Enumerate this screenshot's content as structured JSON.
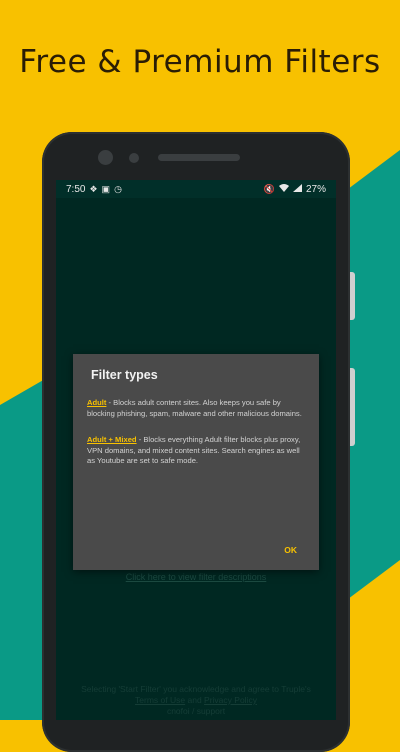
{
  "banner": {
    "headline": "Free & Premium Filters"
  },
  "colors": {
    "brand_yellow": "#F8C100",
    "brand_teal": "#0A9A86",
    "screen_bg": "#003B33"
  },
  "status_bar": {
    "time": "7:50",
    "left_icons": [
      "dropbox-icon",
      "image-icon",
      "clock-icon"
    ],
    "right_icons": [
      "mute-icon",
      "wifi-icon",
      "signal-icon"
    ],
    "battery": "27%"
  },
  "dialog": {
    "title": "Filter types",
    "adult_term": "Adult",
    "adult_desc": " - Blocks adult content sites. Also keeps you safe by blocking phishing, spam, malware and other malicious domains.",
    "mixed_term": "Adult + Mixed",
    "mixed_desc": " - Blocks everything Adult filter blocks plus proxy, VPN domains, and mixed content sites. Search engines as well as Youtube are set to safe mode.",
    "ok_label": "OK"
  },
  "background_screen": {
    "filter_link": "Click here to view filter descriptions",
    "footer_text": "Selecting 'Start Filter' you acknowledge and agree to Truple's",
    "terms_label": "Terms of Use",
    "and_text": "and",
    "privacy_label": "Privacy Policy",
    "support_path": "cnofoi / support"
  }
}
